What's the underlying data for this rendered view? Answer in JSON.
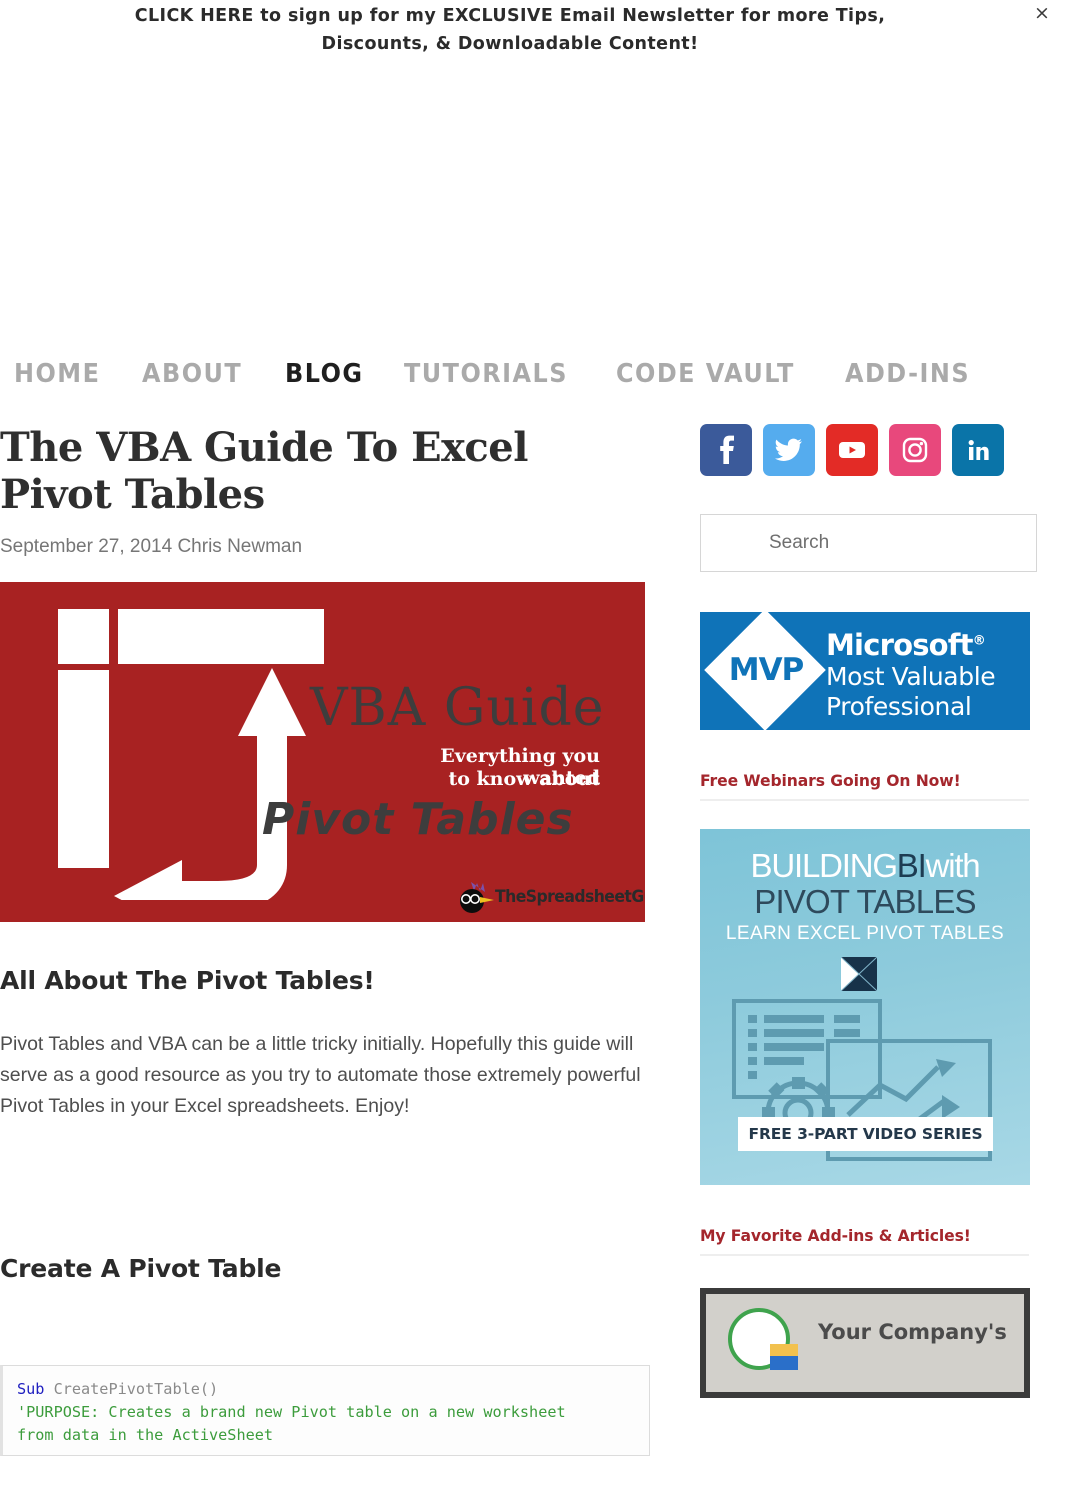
{
  "optin_bar": {
    "link_text": "CLICK HERE",
    "rest_line1": " to sign up for my EXCLUSIVE Email Newsletter for more Tips,",
    "line2": "Discounts, & Downloadable Content!",
    "close_label": "×"
  },
  "nav": {
    "items": [
      {
        "label": "HOME",
        "active": false
      },
      {
        "label": "ABOUT",
        "active": false
      },
      {
        "label": "BLOG",
        "active": true
      },
      {
        "label": "TUTORIALS",
        "active": false
      },
      {
        "label": "CODE VAULT",
        "active": false
      },
      {
        "label": "ADD-INS",
        "active": false
      }
    ]
  },
  "post": {
    "title": "The VBA Guide To Excel Pivot Tables",
    "meta": "September 27, 2014 Chris Newman",
    "featured_image": {
      "background_color": "#a82222",
      "heading": "VBA Guide",
      "sub_line1": "Everything you wanted",
      "sub_line2": "to know about",
      "topic": "Pivot Tables",
      "logo_text": "TheSpreadsheetGuru.com"
    },
    "heading_1": "All About The Pivot Tables!",
    "paragraph_1": "Pivot Tables and VBA can be a little tricky initially.  Hopefully this guide will serve as a good resource as you try to automate those extremely powerful Pivot Tables in your Excel spreadsheets.  Enjoy!",
    "heading_2": "Create A Pivot Table",
    "code": {
      "line1_kw": "Sub",
      "line1_rest": " CreatePivotTable()",
      "line2": "'PURPOSE: Creates a brand new Pivot table on a new worksheet",
      "line3": "from data in the ActiveSheet"
    }
  },
  "sidebar": {
    "social": [
      {
        "name": "facebook",
        "glyph": "f",
        "color": "#3b5a9a"
      },
      {
        "name": "twitter",
        "glyph": "t",
        "color": "#55acee"
      },
      {
        "name": "youtube",
        "glyph": "y",
        "color": "#e32b26"
      },
      {
        "name": "instagram",
        "glyph": "i",
        "color": "#e8487c"
      },
      {
        "name": "linkedin",
        "glyph": "in",
        "color": "#0a74a8"
      }
    ],
    "search": {
      "placeholder": "Search",
      "value": ""
    },
    "mvp_badge": {
      "diamond_text": "MVP",
      "line1": "Microsoft",
      "line1_sup": "®",
      "line2": "Most Valuable",
      "line3": "Professional",
      "color": "#0f73b8"
    },
    "widget_1_title": "Free Webinars Going On Now!",
    "bi_ad": {
      "line1_a": "BUILDING",
      "line1_b": "BI",
      "line1_c": "with",
      "line2": "PIVOT TABLES",
      "line3": "LEARN EXCEL PIVOT TABLES",
      "cta": "FREE 3-PART VIDEO SERIES"
    },
    "widget_2_title": "My Favorite Add-ins & Articles!",
    "addin_ad": {
      "text": "Your Company's"
    }
  },
  "colors": {
    "accent_red": "#a4262c",
    "image_red": "#a82222",
    "nav_inactive": "#aaaaaa",
    "nav_active": "#1f1f1f"
  }
}
